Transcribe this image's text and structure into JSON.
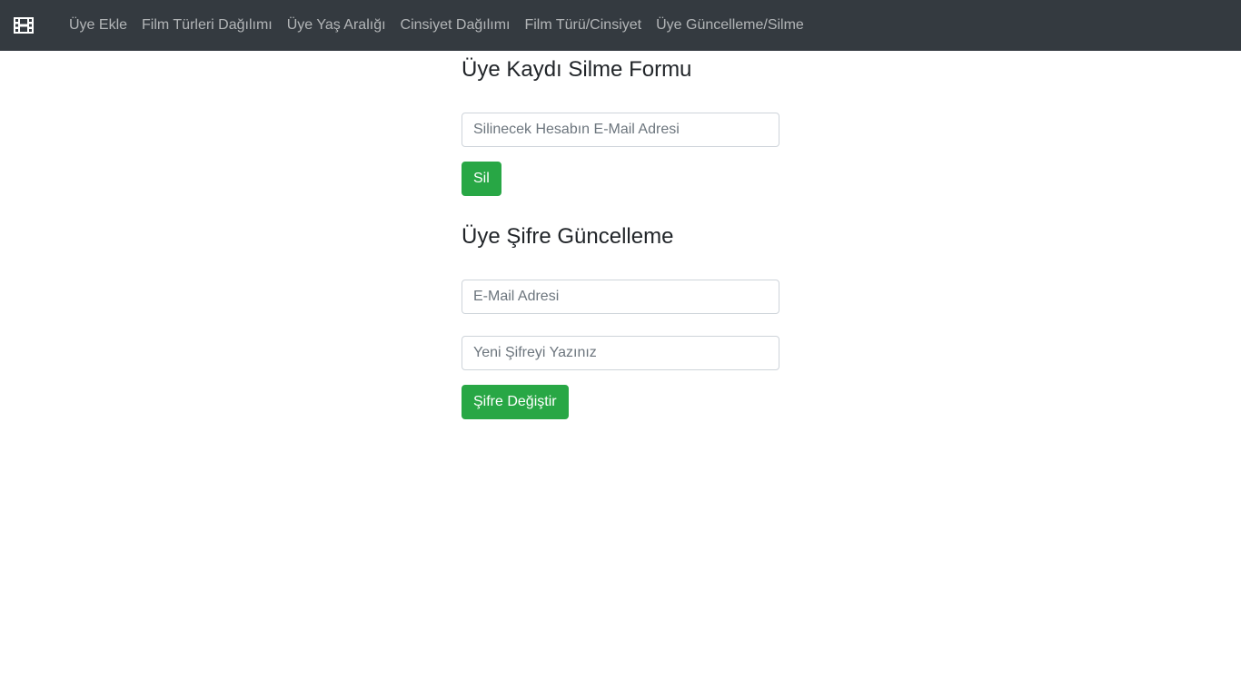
{
  "navbar": {
    "brand_icon": "film-icon",
    "links": [
      {
        "label": "Üye Ekle"
      },
      {
        "label": "Film Türleri Dağılımı"
      },
      {
        "label": "Üye Yaş Aralığı"
      },
      {
        "label": "Cinsiyet Dağılımı"
      },
      {
        "label": "Film Türü/Cinsiyet"
      },
      {
        "label": "Üye Güncelleme/Silme"
      }
    ]
  },
  "delete_form": {
    "title": "Üye Kaydı Silme Formu",
    "email_placeholder": "Silinecek Hesabın E-Mail Adresi",
    "email_value": "",
    "submit_label": "Sil"
  },
  "update_form": {
    "title": "Üye Şifre Güncelleme",
    "email_placeholder": "E-Mail Adresi",
    "email_value": "",
    "password_placeholder": "Yeni Şifreyi Yazınız",
    "password_value": "",
    "submit_label": "Şifre Değiştir"
  },
  "colors": {
    "navbar_bg": "#343a40",
    "success": "#28a745"
  }
}
